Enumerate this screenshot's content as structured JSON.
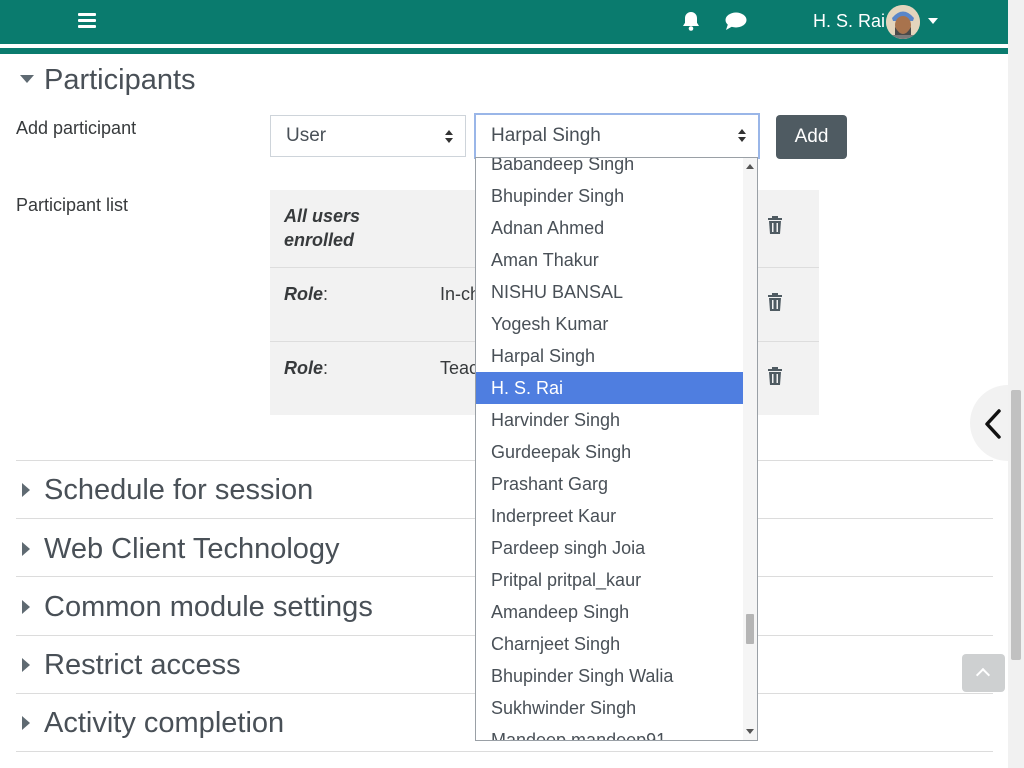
{
  "header": {
    "username": "H. S. Rai",
    "icons": {
      "menu": "hamburger-menu-icon",
      "notifications": "bell-icon",
      "messages": "chat-bubble-icon",
      "user_menu": "caret-down-icon"
    }
  },
  "sections": {
    "participants": {
      "title": "Participants",
      "expanded": true
    },
    "schedule": {
      "title": "Schedule for session",
      "expanded": false
    },
    "web_client": {
      "title": "Web Client Technology",
      "expanded": false
    },
    "common_module": {
      "title": "Common module settings",
      "expanded": false
    },
    "restrict_access": {
      "title": "Restrict access",
      "expanded": false
    },
    "activity_completion": {
      "title": "Activity completion",
      "expanded": false
    }
  },
  "add_participant": {
    "label": "Add participant",
    "type_select": {
      "value": "User"
    },
    "participant_select": {
      "value": "Harpal Singh"
    },
    "add_button": "Add"
  },
  "participant_list": {
    "label": "Participant list",
    "rows": [
      {
        "key": "All users enrolled",
        "value": ""
      },
      {
        "key": "Role",
        "value": "In-ch"
      },
      {
        "key": "Role",
        "value": "Teac"
      }
    ]
  },
  "dropdown": {
    "items": [
      "Babandeep Singh",
      "Bhupinder Singh",
      "Adnan Ahmed",
      "Aman Thakur",
      "NISHU BANSAL",
      "Yogesh Kumar",
      "Harpal Singh",
      "H. S. Rai",
      "Harvinder Singh",
      "Gurdeepak Singh",
      "Prashant Garg",
      "Inderpreet Kaur",
      "Pardeep singh Joia",
      "Pritpal pritpal_kaur",
      "Amandeep Singh",
      "Charnjeet Singh",
      "Bhupinder Singh Walia",
      "Sukhwinder Singh",
      "Mandeep mandeep91"
    ],
    "highlighted": "H. S. Rai"
  },
  "colors": {
    "navbar": "#0a7b6e",
    "highlight": "#4f7ee0",
    "add_button": "#4f5b62"
  }
}
